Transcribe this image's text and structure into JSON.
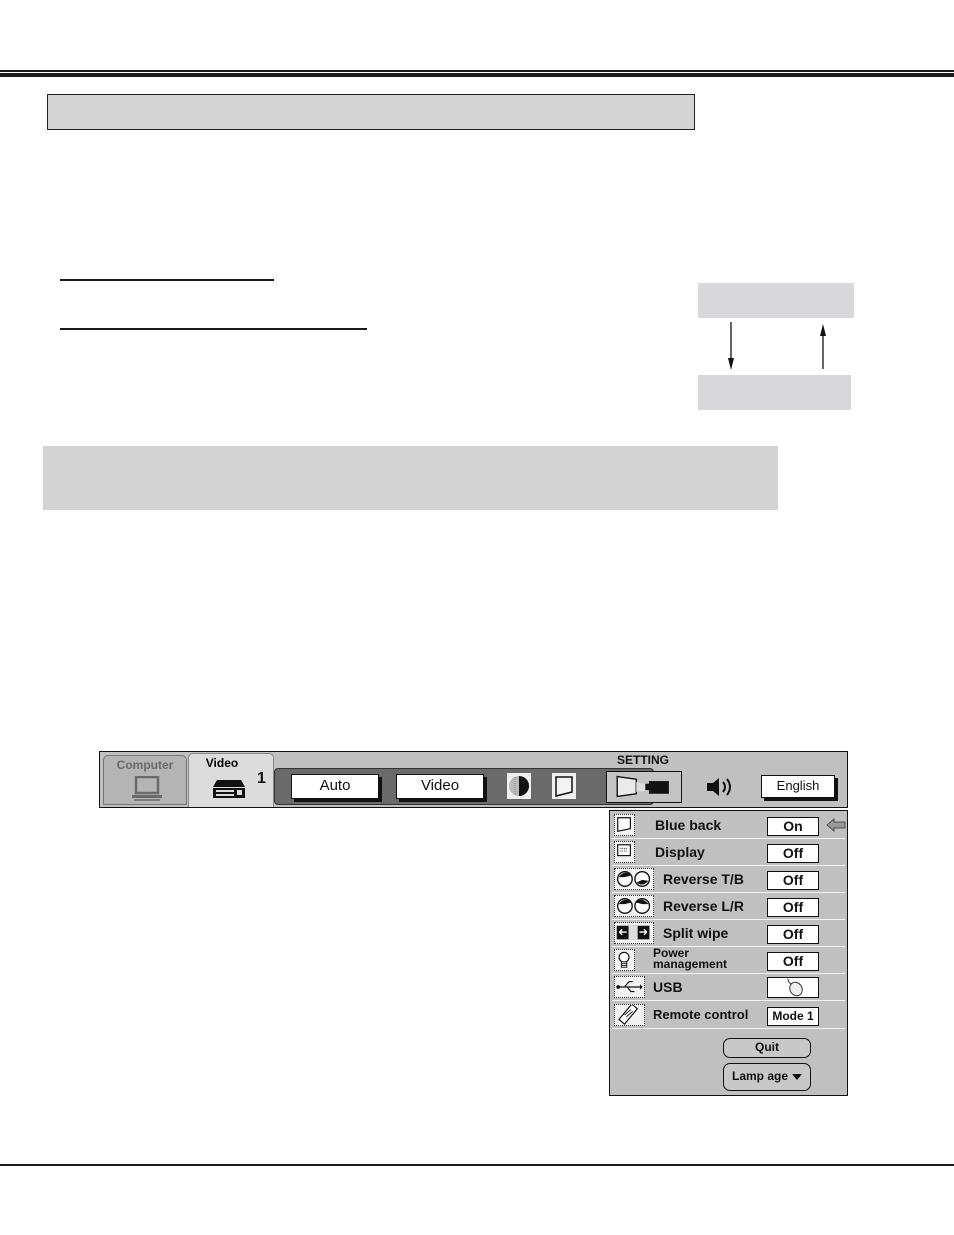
{
  "document": {
    "section_header": "",
    "note_box": "",
    "mode_box_top": "",
    "mode_box_bottom": ""
  },
  "osd": {
    "tabs": [
      {
        "label": "Computer",
        "icon": "computer-icon",
        "active": false
      },
      {
        "label": "Video",
        "icon": "vcr-icon",
        "active": true,
        "input_number": "1"
      }
    ],
    "video_buttons": {
      "system": "Auto",
      "mode": "Video"
    },
    "setting_label": "SETTING",
    "language": "English",
    "colors": {
      "menu_bg": "#c0c0c0",
      "group_bg": "#6a6a6a",
      "box_bg": "#ffffff"
    }
  },
  "settings_panel": {
    "rows": [
      {
        "label": "Blue back",
        "value": "On",
        "icon": "blue-back-icon",
        "selected": true
      },
      {
        "label": "Display",
        "value": "Off",
        "icon": "display-icon"
      },
      {
        "label": "Reverse T/B",
        "value": "Off",
        "icon": "reverse-tb-icon"
      },
      {
        "label": "Reverse L/R",
        "value": "Off",
        "icon": "reverse-lr-icon"
      },
      {
        "label": "Split wipe",
        "value": "Off",
        "icon": "split-wipe-icon"
      },
      {
        "label_line1": "Power",
        "label_line2": "management",
        "value": "Off",
        "icon": "lamp-bulb-icon"
      },
      {
        "label": "USB",
        "value": "",
        "icon": "usb-icon",
        "value_icon": "mouse-icon"
      },
      {
        "label": "Remote control",
        "value": "Mode 1",
        "icon": "remote-control-icon"
      }
    ],
    "quit_label": "Quit",
    "lamp_age_label": "Lamp age"
  }
}
